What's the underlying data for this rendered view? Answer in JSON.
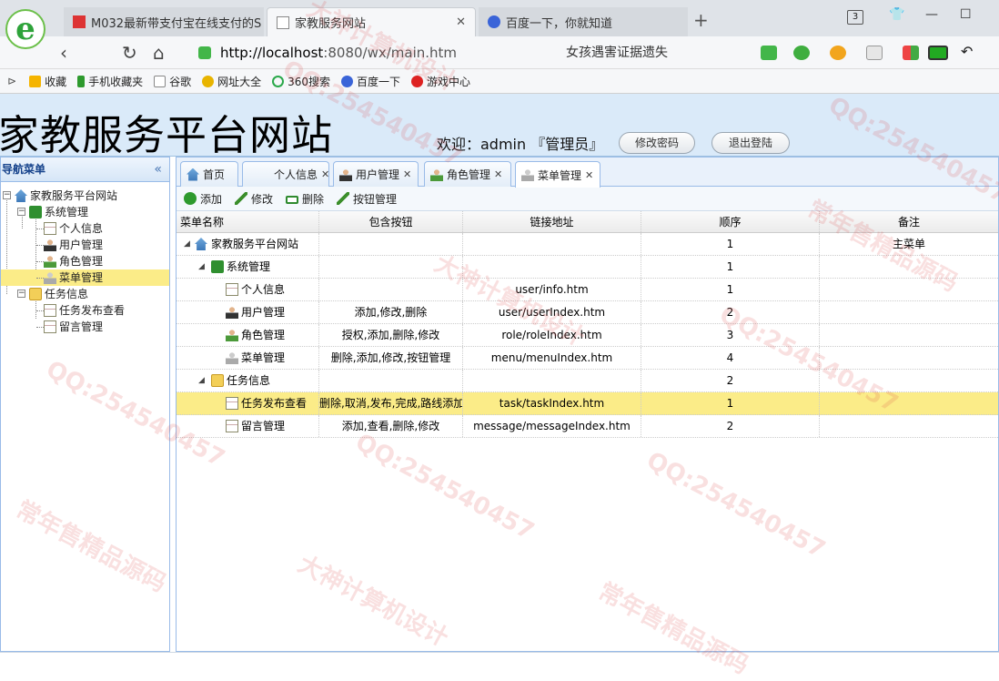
{
  "browser": {
    "tabs": [
      {
        "label": "M032最新带支付宝在线支付的S"
      },
      {
        "label": "家教服务网站"
      },
      {
        "label": "百度一下，你就知道"
      }
    ],
    "tab_count": "3",
    "url_host": "http://localhost",
    "url_rest": ":8080/wx/main.htm",
    "search_text": "女孩遇害证据遗失",
    "bookmarks": [
      "收藏",
      "手机收藏夹",
      "谷歌",
      "网址大全",
      "360搜索",
      "百度一下",
      "游戏中心"
    ]
  },
  "header": {
    "site_title": "家教服务平台网站",
    "welcome": "欢迎：admin 『管理员』",
    "change_password": "修改密码",
    "logout": "退出登陆"
  },
  "sidebar": {
    "title": "导航菜单",
    "collapse": "«",
    "tree": [
      {
        "label": "家教服务平台网站",
        "icon": "home-icon"
      },
      {
        "label": "系统管理",
        "icon": "gear-icon"
      },
      {
        "label": "个人信息",
        "icon": "page-icon"
      },
      {
        "label": "用户管理",
        "icon": "user-icon"
      },
      {
        "label": "角色管理",
        "icon": "role-icon"
      },
      {
        "label": "菜单管理",
        "icon": "menu-icon"
      },
      {
        "label": "任务信息",
        "icon": "folder-icon"
      },
      {
        "label": "任务发布查看",
        "icon": "page-icon"
      },
      {
        "label": "留言管理",
        "icon": "page-icon"
      }
    ]
  },
  "content_tabs": [
    {
      "label": "首页",
      "closable": false
    },
    {
      "label": "个人信息",
      "closable": true
    },
    {
      "label": "用户管理",
      "closable": true
    },
    {
      "label": "角色管理",
      "closable": true
    },
    {
      "label": "菜单管理",
      "closable": true
    }
  ],
  "toolbar": {
    "add": "添加",
    "edit": "修改",
    "delete": "删除",
    "button_manage": "按钮管理"
  },
  "grid": {
    "columns": [
      "菜单名称",
      "包含按钮",
      "链接地址",
      "顺序",
      "备注"
    ],
    "rows": [
      {
        "name": "家教服务平台网站",
        "buttons": "",
        "url": "",
        "order": "1",
        "note": "主菜单"
      },
      {
        "name": "系统管理",
        "buttons": "",
        "url": "",
        "order": "1",
        "note": ""
      },
      {
        "name": "个人信息",
        "buttons": "",
        "url": "user/info.htm",
        "order": "1",
        "note": ""
      },
      {
        "name": "用户管理",
        "buttons": "添加,修改,删除",
        "url": "user/userIndex.htm",
        "order": "2",
        "note": ""
      },
      {
        "name": "角色管理",
        "buttons": "授权,添加,删除,修改",
        "url": "role/roleIndex.htm",
        "order": "3",
        "note": ""
      },
      {
        "name": "菜单管理",
        "buttons": "删除,添加,修改,按钮管理",
        "url": "menu/menuIndex.htm",
        "order": "4",
        "note": ""
      },
      {
        "name": "任务信息",
        "buttons": "",
        "url": "",
        "order": "2",
        "note": ""
      },
      {
        "name": "任务发布查看",
        "buttons": "删除,取消,发布,完成,路线添加",
        "url": "task/taskIndex.htm",
        "order": "1",
        "note": ""
      },
      {
        "name": "留言管理",
        "buttons": "添加,查看,删除,修改",
        "url": "message/messageIndex.htm",
        "order": "2",
        "note": ""
      }
    ]
  },
  "watermark": {
    "qq": "QQ:254540457",
    "tag1": "大神计算机设计",
    "tag2": "常年售精品源码"
  }
}
